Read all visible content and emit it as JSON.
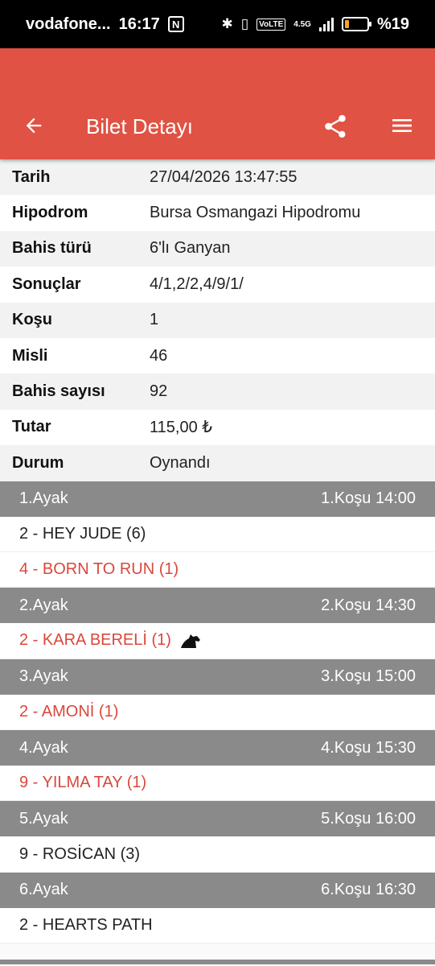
{
  "status_bar": {
    "carrier": "vodafone...",
    "time": "16:17",
    "network": "4.5G",
    "volte": "VoLTE",
    "battery_text": "%19",
    "battery_level": 0.19
  },
  "app_bar": {
    "title": "Bilet Detayı"
  },
  "details": [
    {
      "label": "Tarih",
      "value": "27/04/2026 13:47:55"
    },
    {
      "label": "Hipodrom",
      "value": "Bursa Osmangazi Hipodromu"
    },
    {
      "label": "Bahis türü",
      "value": "6'lı Ganyan"
    },
    {
      "label": "Sonuçlar",
      "value": "4/1,2/2,4/9/1/"
    },
    {
      "label": "Koşu",
      "value": "1"
    },
    {
      "label": "Misli",
      "value": "46"
    },
    {
      "label": "Bahis sayısı",
      "value": "92"
    },
    {
      "label": "Tutar",
      "value": "115,00 ₺"
    },
    {
      "label": "Durum",
      "value": "Oynandı"
    }
  ],
  "legs": [
    {
      "leg": "1.Ayak",
      "race": "1.Koşu 14:00",
      "horses": [
        {
          "text": "2 - HEY JUDE (6)",
          "winner": false
        },
        {
          "text": "4 - BORN TO RUN (1)",
          "winner": true
        }
      ]
    },
    {
      "leg": "2.Ayak",
      "race": "2.Koşu 14:30",
      "horses": [
        {
          "text": "2 - KARA BERELİ (1)",
          "winner": true,
          "icon": "horse-head-icon"
        }
      ]
    },
    {
      "leg": "3.Ayak",
      "race": "3.Koşu 15:00",
      "horses": [
        {
          "text": "2 - AMONİ (1)",
          "winner": true
        }
      ]
    },
    {
      "leg": "4.Ayak",
      "race": "4.Koşu 15:30",
      "horses": [
        {
          "text": "9 - YILMA TAY (1)",
          "winner": true
        }
      ]
    },
    {
      "leg": "5.Ayak",
      "race": "5.Koşu 16:00",
      "horses": [
        {
          "text": "9 - ROSİCAN (3)",
          "winner": false
        }
      ]
    },
    {
      "leg": "6.Ayak",
      "race": "6.Koşu 16:30",
      "horses": [
        {
          "text": "2 - HEARTS PATH",
          "winner": false
        }
      ]
    }
  ],
  "colors": {
    "app_bar": "#e05243",
    "winner_text": "#d9483b",
    "leg_header": "#8a8a8a"
  }
}
